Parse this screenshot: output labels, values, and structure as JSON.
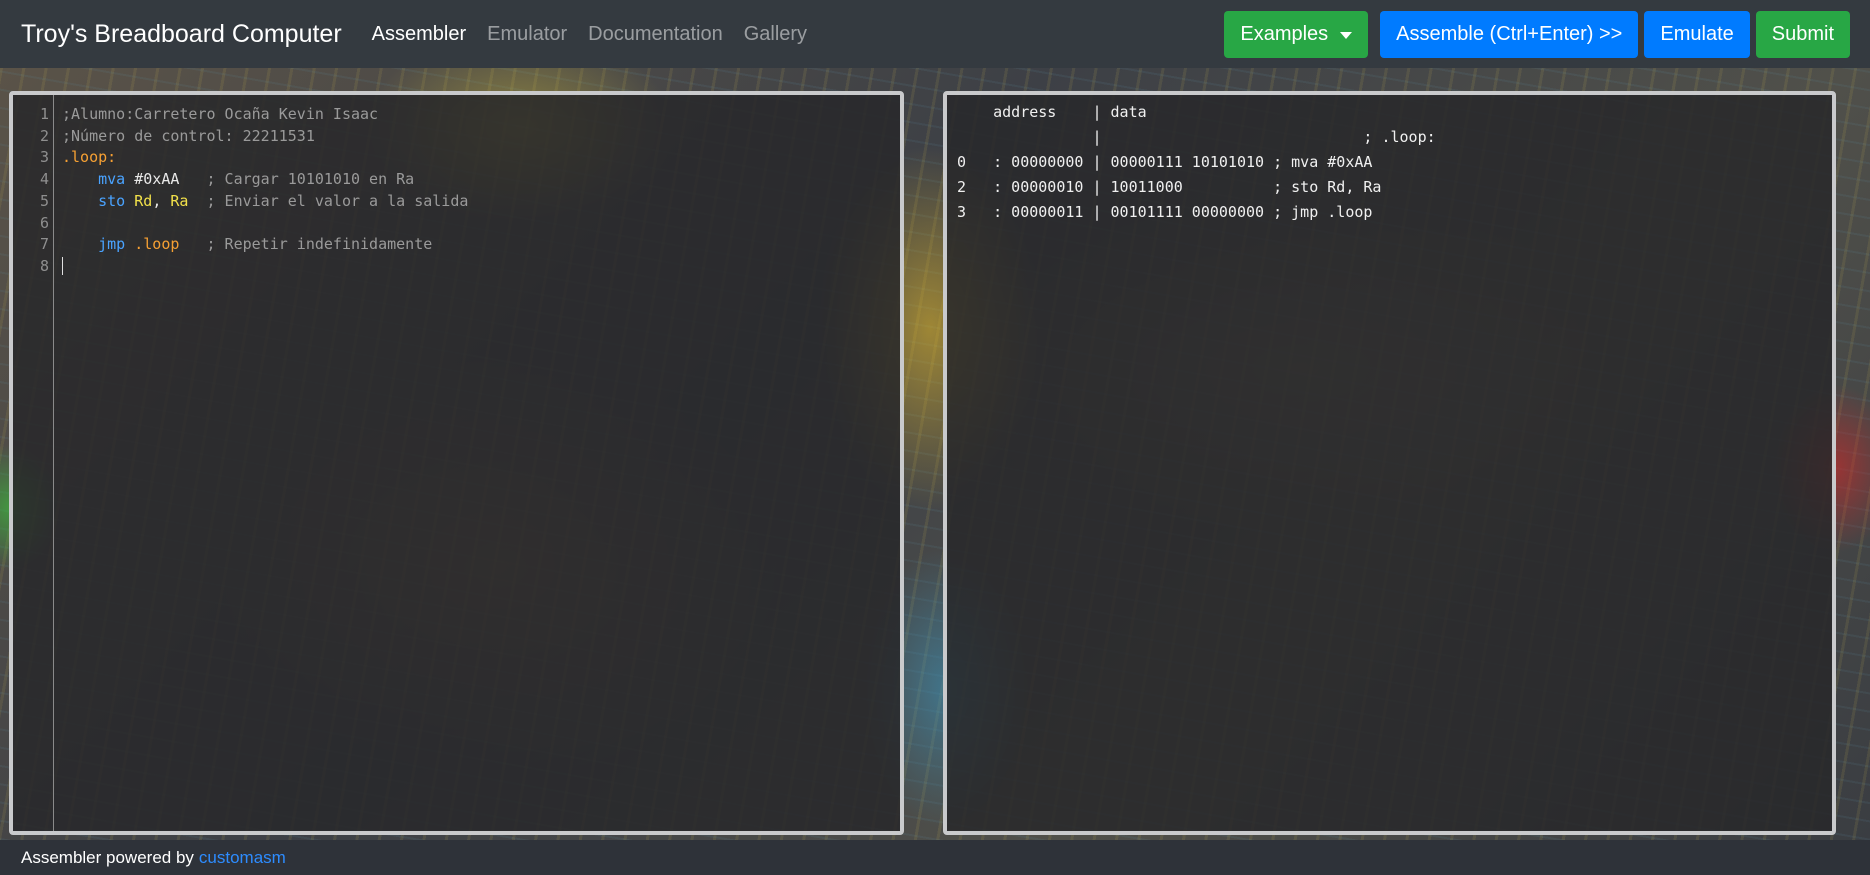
{
  "navbar": {
    "brand": "Troy's Breadboard Computer",
    "links": [
      "Assembler",
      "Emulator",
      "Documentation",
      "Gallery"
    ],
    "active": "Assembler",
    "examples_label": "Examples",
    "assemble_label": "Assemble (Ctrl+Enter) >>",
    "emulate_label": "Emulate",
    "submit_label": "Submit"
  },
  "editor": {
    "line_numbers": [
      "1",
      "2",
      "3",
      "4",
      "5",
      "6",
      "7",
      "8"
    ],
    "lines": [
      {
        "comment": ";Alumno:Carretero Ocaña Kevin Isaac"
      },
      {
        "comment": ";Número de control: 22211531"
      },
      {
        "label": ".loop:"
      },
      {
        "mnemonic": "mva",
        "arg1": "#0xAA",
        "comment": "; Cargar 10101010 en Ra"
      },
      {
        "mnemonic": "sto",
        "reg1": "Rd",
        "sep": ",",
        "reg2": "Ra",
        "comment": "; Enviar el valor a la salida"
      },
      {},
      {
        "mnemonic": "jmp",
        "target": ".loop",
        "comment": "; Repetir indefinidamente"
      },
      {}
    ]
  },
  "output": {
    "header": "    address    | data",
    "lines": [
      "               |                             ; .loop:",
      "0   : 00000000 | 00000111 10101010 ; mva #0xAA",
      "2   : 00000010 | 10011000          ; sto Rd, Ra",
      "3   : 00000011 | 00101111 00000000 ; jmp .loop"
    ]
  },
  "footer": {
    "text": "Assembler powered by",
    "link": "customasm"
  },
  "colors": {
    "navbar": "#343a40",
    "green": "#28a745",
    "blue": "#007bff",
    "comment": "#9a9a9a",
    "label": "#f6a033",
    "mnemonic": "#4aa3ff",
    "register": "#f2e14a"
  }
}
